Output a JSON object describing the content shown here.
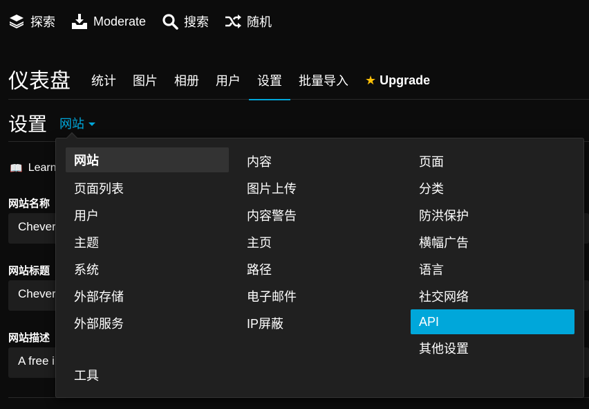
{
  "topbar": {
    "items": [
      {
        "label": "探索",
        "icon": "layers-icon"
      },
      {
        "label": "Moderate",
        "icon": "inbox-download-icon"
      },
      {
        "label": "搜索",
        "icon": "search-icon"
      },
      {
        "label": "随机",
        "icon": "shuffle-icon"
      }
    ]
  },
  "header": {
    "title": "仪表盘",
    "nav": [
      "统计",
      "图片",
      "相册",
      "用户",
      "设置",
      "批量导入"
    ],
    "active_nav": "设置",
    "upgrade_label": "Upgrade",
    "upgrade_icon": "star-icon"
  },
  "settings": {
    "title": "设置",
    "section_dropdown": "网站"
  },
  "form": {
    "learn_label": "Learn",
    "fields": [
      {
        "label": "网站名称",
        "value": "Chevere"
      },
      {
        "label": "网站标题",
        "value": "Chevere"
      },
      {
        "label": "网站描述",
        "value": "A free i"
      }
    ]
  },
  "dropdown": {
    "columns": [
      [
        "网站",
        "页面列表",
        "用户",
        "主题",
        "系统",
        "外部存储",
        "外部服务",
        "",
        "工具"
      ],
      [
        "内容",
        "图片上传",
        "内容警告",
        "主页",
        "路径",
        "电子邮件",
        "IP屏蔽"
      ],
      [
        "页面",
        "分类",
        "防洪保护",
        "横幅广告",
        "语言",
        "社交网络",
        "API",
        "其他设置"
      ]
    ],
    "selected": "网站",
    "highlighted": "API"
  },
  "colors": {
    "accent": "#00a7da",
    "star": "#ffc107",
    "background": "#0c0c0c",
    "panel": "#202020"
  }
}
